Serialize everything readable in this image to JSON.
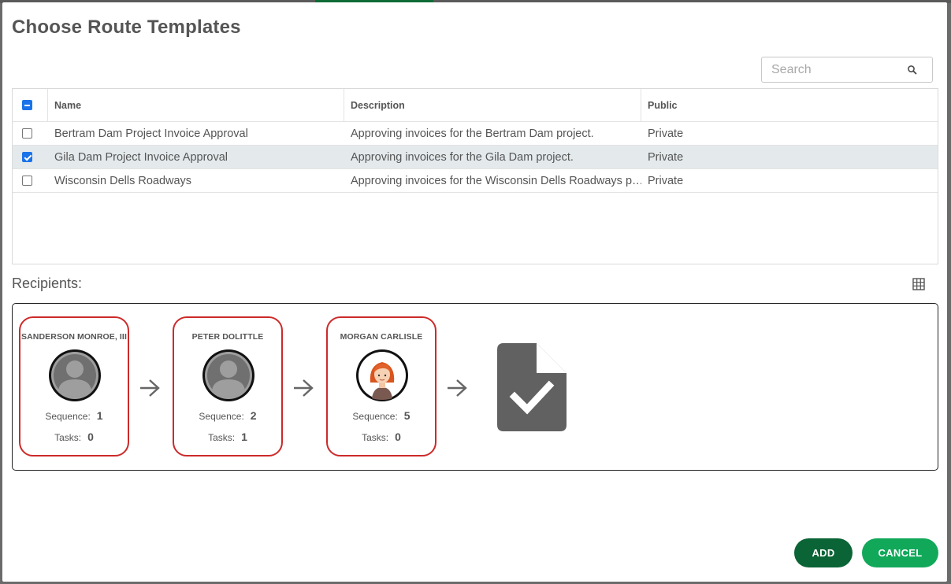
{
  "dialog": {
    "title": "Choose Route Templates"
  },
  "search": {
    "placeholder": "Search",
    "value": ""
  },
  "table": {
    "columns": [
      "Name",
      "Description",
      "Public"
    ],
    "rows": [
      {
        "name": "Bertram Dam Project Invoice Approval",
        "description": "Approving invoices for the Bertram Dam project.",
        "public": "Private",
        "checked": false
      },
      {
        "name": "Gila Dam Project Invoice Approval",
        "description": "Approving invoices for the Gila Dam project.",
        "public": "Private",
        "checked": true
      },
      {
        "name": "Wisconsin Dells Roadways",
        "description": "Approving invoices for the Wisconsin Dells Roadways p…",
        "public": "Private",
        "checked": false
      }
    ]
  },
  "recipients": {
    "label": "Recipients:",
    "sequence_label": "Sequence:",
    "tasks_label": "Tasks:",
    "cards": [
      {
        "name": "SANDERSON MONROE, III",
        "sequence": "1",
        "tasks": "0",
        "avatar": "user-silhouette-icon"
      },
      {
        "name": "PETER DOLITTLE",
        "sequence": "2",
        "tasks": "1",
        "avatar": "user-silhouette-icon"
      },
      {
        "name": "MORGAN CARLISLE",
        "sequence": "5",
        "tasks": "0",
        "avatar": "red-haired-woman-avatar"
      }
    ],
    "end_icon": "document-check-icon"
  },
  "buttons": {
    "add": "ADD",
    "cancel": "CANCEL"
  },
  "colors": {
    "card_border": "#cc2a2a",
    "add_button": "#0b6436",
    "cancel_button": "#12a85a",
    "selected_row": "#e4eaec",
    "checkbox": "#1a73e8"
  }
}
